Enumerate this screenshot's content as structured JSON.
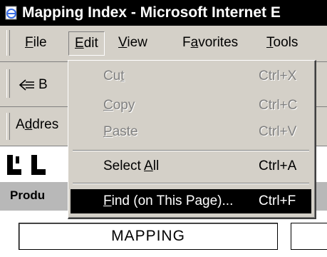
{
  "window": {
    "title": "Mapping Index - Microsoft Internet E"
  },
  "menubar": {
    "items": [
      {
        "label_u": "F",
        "label_rest": "ile"
      },
      {
        "label_u": "E",
        "label_rest": "dit"
      },
      {
        "label_u": "V",
        "label_rest": "iew"
      },
      {
        "label_pre": "F",
        "label_u": "a",
        "label_rest": "vorites"
      },
      {
        "label_u": "T",
        "label_rest": "ools"
      }
    ]
  },
  "toolbar": {
    "back_label": "B"
  },
  "address": {
    "label_pre": "A",
    "label_u": "d",
    "label_rest": "dres"
  },
  "page": {
    "nav_products": "Produ",
    "mapping_button": "MAPPING"
  },
  "edit_menu": {
    "cut": {
      "pre": "Cu",
      "u": "t",
      "post": "",
      "shortcut": "Ctrl+X"
    },
    "copy": {
      "pre": "",
      "u": "C",
      "post": "opy",
      "shortcut": "Ctrl+C"
    },
    "paste": {
      "pre": "",
      "u": "P",
      "post": "aste",
      "shortcut": "Ctrl+V"
    },
    "select_all": {
      "pre": "Select ",
      "u": "A",
      "post": "ll",
      "shortcut": "Ctrl+A"
    },
    "find": {
      "pre": "",
      "u": "F",
      "post": "ind (on This Page)...",
      "shortcut": "Ctrl+F"
    }
  }
}
